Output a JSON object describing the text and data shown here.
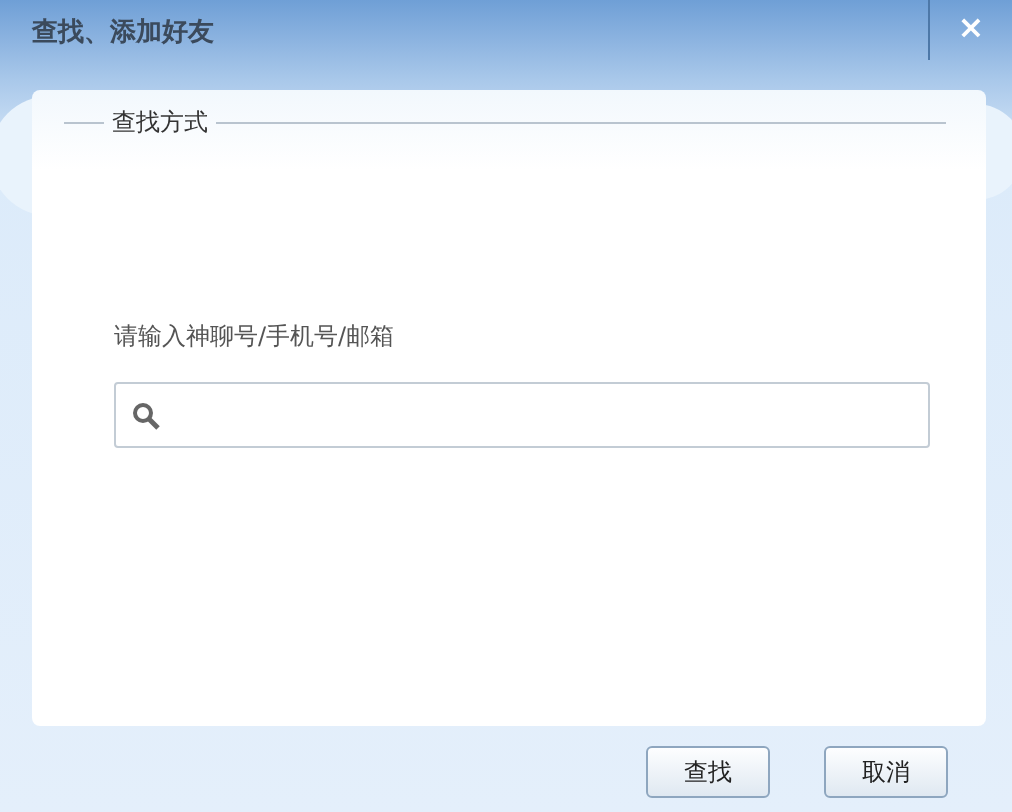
{
  "window": {
    "title": "查找、添加好友",
    "close": "×"
  },
  "group": {
    "title": "查找方式"
  },
  "search": {
    "label": "请输入神聊号/手机号/邮箱"
  },
  "buttons": [
    {
      "label": "查找"
    },
    {
      "label": "取消"
    }
  ]
}
